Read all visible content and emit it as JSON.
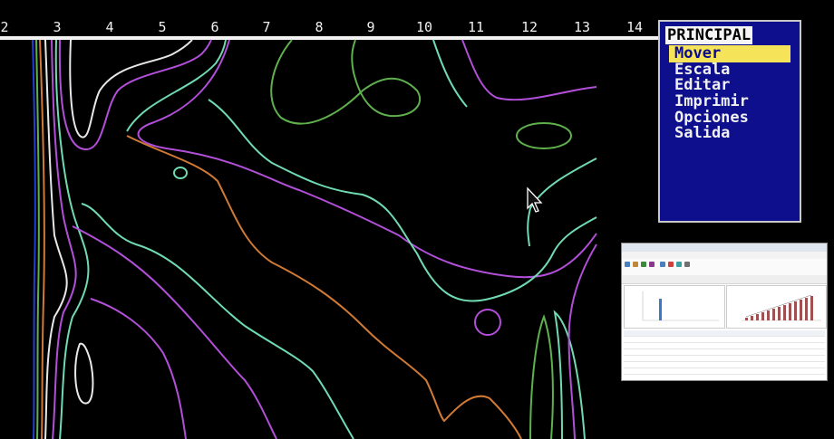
{
  "ruler": {
    "ticks": [
      "2",
      "3",
      "4",
      "5",
      "6",
      "7",
      "8",
      "9",
      "10",
      "11",
      "12",
      "13",
      "14"
    ]
  },
  "menu": {
    "title": "PRINCIPAL",
    "items": [
      {
        "label": "Mover",
        "selected": true
      },
      {
        "label": "Escala",
        "selected": false
      },
      {
        "label": "Editar",
        "selected": false
      },
      {
        "label": "Imprimir",
        "selected": false
      },
      {
        "label": "Opciones",
        "selected": false
      },
      {
        "label": "Salida",
        "selected": false
      }
    ]
  },
  "colors": {
    "background": "#000000",
    "ruler": "#f2f2f2",
    "menu_bg": "#0d0f8c",
    "menu_text": "#f0f0f0",
    "menu_highlight": "#f5e45a",
    "contour_white": "#e8e8e8",
    "contour_magenta": "#b24fd8",
    "contour_cyan": "#70dbb2",
    "contour_green": "#5fb14e",
    "contour_orange": "#d07a35",
    "contour_blue": "#2040d0"
  },
  "cursor": {
    "icon": "arrow-cursor-icon"
  }
}
